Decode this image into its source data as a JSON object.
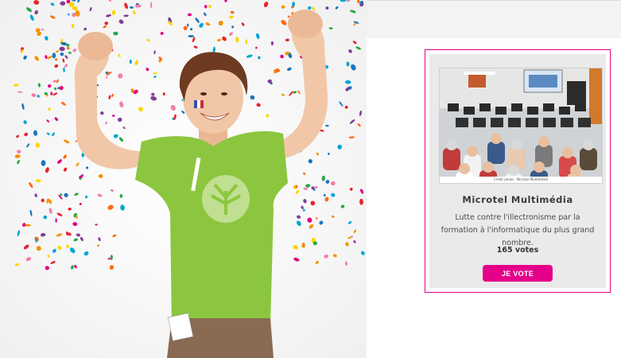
{
  "hero": {
    "image": "woman-celebrating-confetti"
  },
  "card": {
    "image": "microtel-classroom-photo",
    "photo_credit": "Crédit photo : Microtel Multimédia",
    "title": "Microtel Multimédia",
    "description": "Lutte contre l'illectronisme par la formation à l'informatique du plus grand nombre.",
    "votes": "165 votes",
    "vote_button": "JE VOTE",
    "accent_color": "#e5008a",
    "shirt_color": "#8cc63f"
  }
}
